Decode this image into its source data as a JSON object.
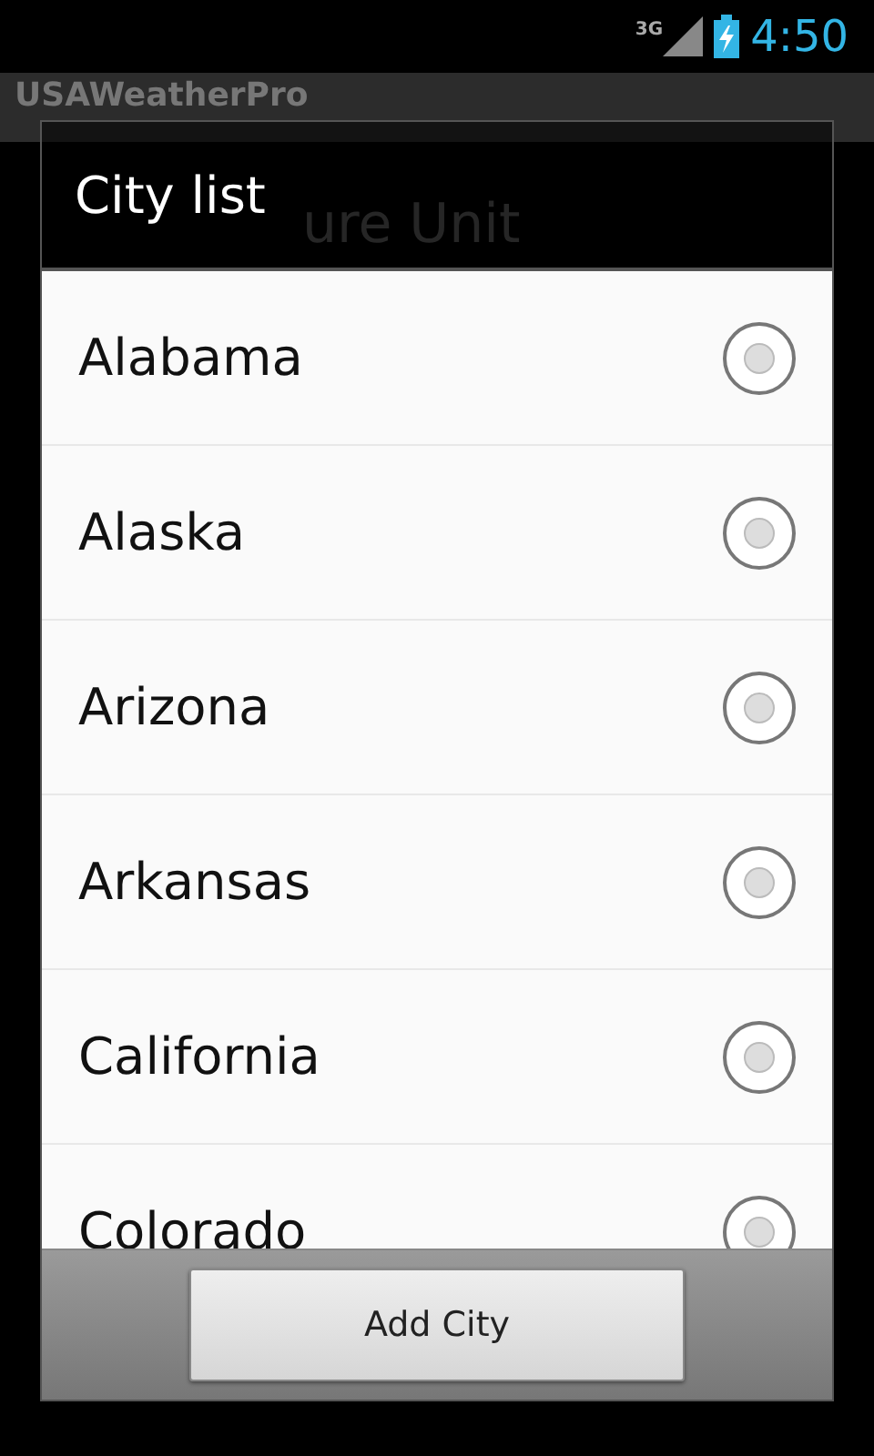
{
  "status_bar": {
    "network": "3G",
    "time": "4:50"
  },
  "app_bar": {
    "title": "USAWeatherPro"
  },
  "background": {
    "heading": "ure Unit"
  },
  "dialog": {
    "title": "City list",
    "items": [
      {
        "label": "Alabama",
        "selected": false
      },
      {
        "label": "Alaska",
        "selected": false
      },
      {
        "label": "Arizona",
        "selected": false
      },
      {
        "label": "Arkansas",
        "selected": false
      },
      {
        "label": "California",
        "selected": false
      },
      {
        "label": "Colorado",
        "selected": false
      }
    ],
    "button": "Add City"
  }
}
